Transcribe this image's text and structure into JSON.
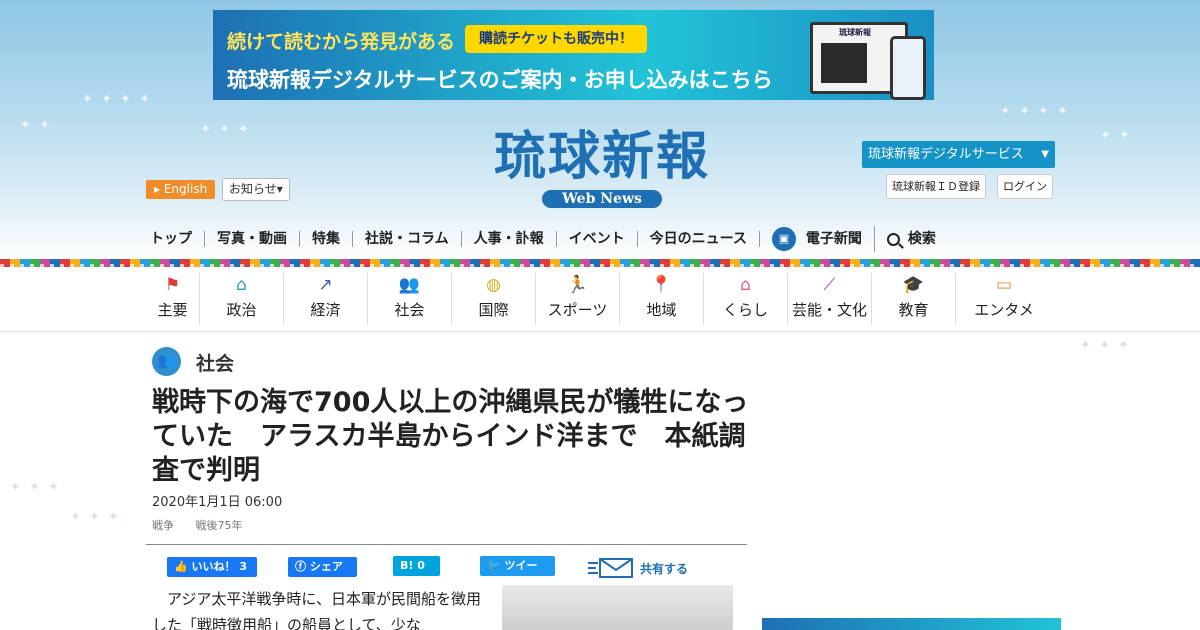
{
  "banner": {
    "line1": "続けて読むから発見がある",
    "pill": "購読チケットも販売中！",
    "line2": "琉球新報デジタルサービスのご案内・お申し込みはこちら",
    "device_title": "琉球新報"
  },
  "header": {
    "logo": "琉球新報",
    "webnews": "Web News",
    "english": "English",
    "notice": "お知らせ",
    "digital_service": "琉球新報デジタルサービス",
    "id_register": "琉球新報ＩＤ登録",
    "login": "ログイン"
  },
  "mainnav": {
    "items": [
      "トップ",
      "写真・動画",
      "特集",
      "社説・コラム",
      "人事・訃報",
      "イベント",
      "今日のニュース",
      "電子新聞",
      "検索"
    ]
  },
  "catnav": {
    "items": [
      {
        "label": "主要",
        "icon": "flag-icon",
        "color": "#e03b3b"
      },
      {
        "label": "政治",
        "icon": "building-icon",
        "color": "#2aa0a8"
      },
      {
        "label": "経済",
        "icon": "chart-icon",
        "color": "#3b5fa8"
      },
      {
        "label": "社会",
        "icon": "people-icon",
        "color": "#2f8fd0"
      },
      {
        "label": "国際",
        "icon": "globe-icon",
        "color": "#d1b21f"
      },
      {
        "label": "スポーツ",
        "icon": "runner-icon",
        "color": "#e0457a"
      },
      {
        "label": "地域",
        "icon": "pin-icon",
        "color": "#5fb34d"
      },
      {
        "label": "くらし",
        "icon": "house-icon",
        "color": "#e05a8a"
      },
      {
        "label": "芸能・文化",
        "icon": "sanshin-icon",
        "color": "#9a3fb0"
      },
      {
        "label": "教育",
        "icon": "graduation-icon",
        "color": "#e0b21f"
      },
      {
        "label": "エンタメ",
        "icon": "tv-icon",
        "color": "#f08c2a"
      }
    ]
  },
  "article": {
    "section": "社会",
    "headline": "戦時下の海で700人以上の沖縄県民が犠牲になっていた　アラスカ半島からインド洋まで　本紙調査で判明",
    "date": "2020年1月1日 06:00",
    "tags": [
      "戦争",
      "戦後75年"
    ],
    "body": "　アジア太平洋戦争時に、日本軍が民間船を徴用した「戦時徴用船」の船員として、少な"
  },
  "share": {
    "fb_like": "いいね！ 3",
    "fb_share": "シェア",
    "hatena": "B! 0",
    "tweet": "ツイート",
    "mail": "共有する"
  }
}
